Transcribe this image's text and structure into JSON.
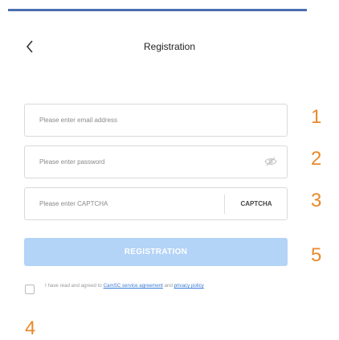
{
  "page": {
    "title": "Registration"
  },
  "form": {
    "email_placeholder": "Please enter email address",
    "password_placeholder": "Please enter password",
    "captcha_placeholder": "Please enter CAPTCHA",
    "captcha_button": "CAPTCHA",
    "register_button": "REGISTRATION",
    "agreement": {
      "checked": false,
      "text_before": "I have read and agreed to ",
      "link_service": "CamSC service agreement",
      "text_middle": " and ",
      "link_privacy": "privacy policy"
    }
  },
  "annotations": {
    "n1": "1",
    "n2": "2",
    "n3": "3",
    "n4": "4",
    "n5": "5"
  },
  "colors": {
    "accent": "#4a6fb0",
    "button_disabled": "#b3d3f7",
    "annotation": "#e8892b",
    "link": "#3a7bd5"
  },
  "icons": {
    "back": "chevron-left-icon",
    "password_visibility": "eye-hidden-icon"
  }
}
